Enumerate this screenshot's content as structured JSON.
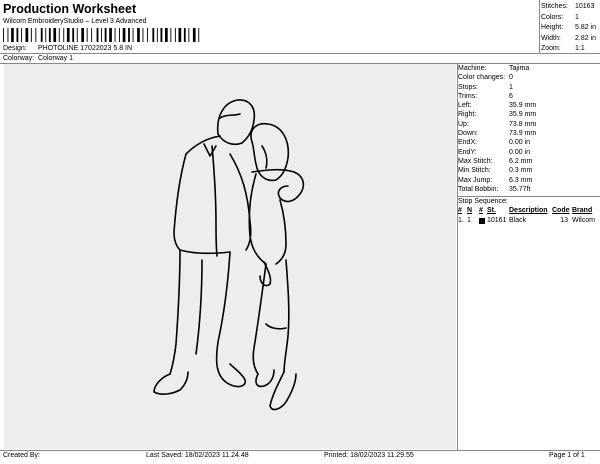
{
  "header": {
    "title": "Production Worksheet",
    "subtitle": "Wilcom EmbroideryStudio – Level 3 Advanced",
    "design_label": "Design:",
    "design_value": "PHOTOLINE 17022023 5.8 IN",
    "colorway_label": "Colorway:",
    "colorway_value": "Colorway 1"
  },
  "stats": [
    {
      "label": "Stitches:",
      "value": "10163"
    },
    {
      "label": "Colors:",
      "value": "1"
    },
    {
      "label": "Height:",
      "value": "5.82 in"
    },
    {
      "label": "Width:",
      "value": "2.82 in"
    },
    {
      "label": "Zoom:",
      "value": "1:1"
    }
  ],
  "machine_info": [
    {
      "label": "Machine:",
      "value": "Tajima"
    },
    {
      "label": "Color changes:",
      "value": "0"
    },
    {
      "label": "Stops:",
      "value": "1"
    },
    {
      "label": "Trims:",
      "value": "6"
    },
    {
      "label": "Left:",
      "value": "35.9 mm"
    },
    {
      "label": "Right:",
      "value": "35.9 mm"
    },
    {
      "label": "Up:",
      "value": "73.8 mm"
    },
    {
      "label": "Down:",
      "value": "73.9 mm"
    },
    {
      "label": "EndX:",
      "value": "0.00 in"
    },
    {
      "label": "EndY:",
      "value": "0.00 in"
    },
    {
      "label": "Max Stitch:",
      "value": "6.2 mm"
    },
    {
      "label": "Min Stitch:",
      "value": "0.3 mm"
    },
    {
      "label": "Max Jump:",
      "value": "6.3 mm"
    },
    {
      "label": "Total Bobbin:",
      "value": "35.77ft"
    }
  ],
  "stop_sequence": {
    "title": "Stop Sequence:",
    "headers": {
      "num": "#",
      "n": "N",
      "code_col": "#",
      "stitches": "St.",
      "description": "Description",
      "code": "Code",
      "brand": "Brand"
    },
    "rows": [
      {
        "num": "1.",
        "n": "1",
        "color": "#000000",
        "stitches": "10161",
        "description": "Black",
        "code": "13",
        "brand": "Wilcom"
      }
    ]
  },
  "footer": {
    "created_by": "Created By:",
    "last_saved": "Last Saved: 18/02/2023 11.24.48",
    "printed": "Printed: 18/02/2023 11.29.55",
    "page": "Page 1 of 1"
  },
  "colors": {
    "thread": "#000000",
    "canvas_bg": "#ededed"
  }
}
